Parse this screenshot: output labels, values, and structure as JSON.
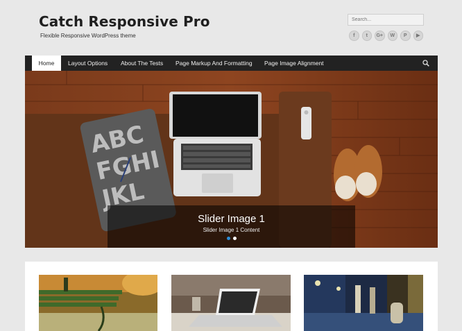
{
  "site": {
    "title": "Catch Responsive Pro",
    "description": "Flexible Responsive WordPress theme"
  },
  "search": {
    "placeholder": "Search..."
  },
  "social": [
    {
      "icon": "facebook-icon",
      "glyph": "f"
    },
    {
      "icon": "twitter-icon",
      "glyph": "t"
    },
    {
      "icon": "google-plus-icon",
      "glyph": "G+"
    },
    {
      "icon": "wordpress-icon",
      "glyph": "W"
    },
    {
      "icon": "pinterest-icon",
      "glyph": "P"
    },
    {
      "icon": "youtube-icon",
      "glyph": "▶"
    }
  ],
  "nav": {
    "items": [
      {
        "label": "Home",
        "active": true
      },
      {
        "label": "Layout Options"
      },
      {
        "label": "About The Tests"
      },
      {
        "label": "Page Markup And Formatting"
      },
      {
        "label": "Page Image Alignment"
      }
    ]
  },
  "slider": {
    "title": "Slider Image 1",
    "content": "Slider Image 1 Content",
    "active_dot": 0,
    "dot_count": 2
  },
  "colors": {
    "nav_bg": "#222222",
    "accent": "#2c8dd8",
    "page_bg": "#e8e8e8"
  }
}
